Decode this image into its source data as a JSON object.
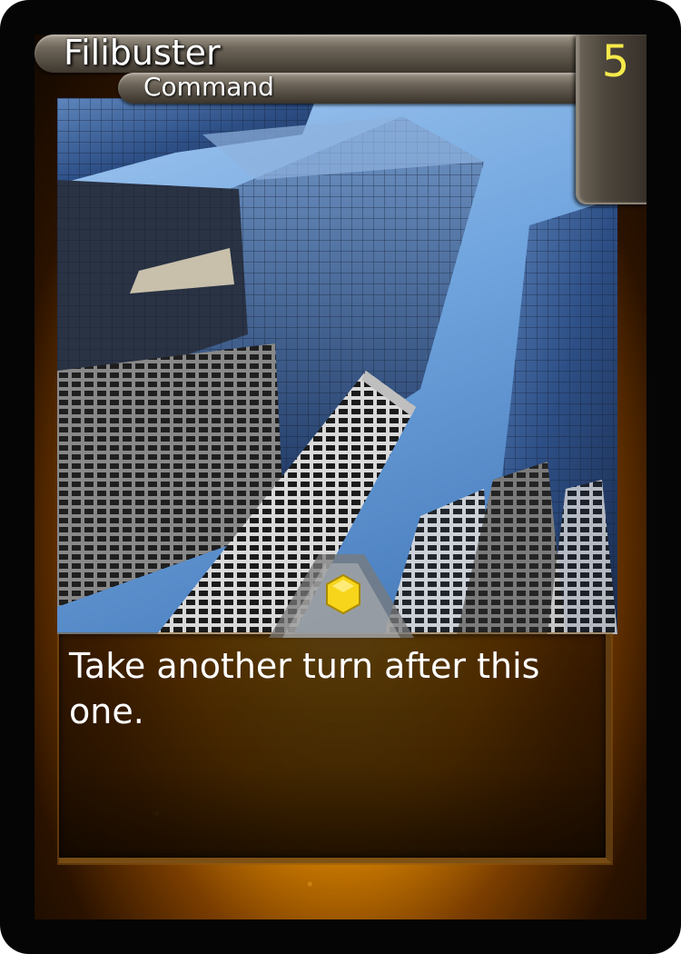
{
  "card": {
    "name": "Filibuster",
    "type": "Command",
    "cost": "5",
    "rules_text": "Take another turn after this one."
  },
  "art": {
    "description_icon": "skyscrapers-art"
  },
  "colors": {
    "frame_accent": "#ffc21a",
    "cost_text": "#f5ea4a",
    "gem": "#f7d51a",
    "text_color": "#ffffff"
  }
}
